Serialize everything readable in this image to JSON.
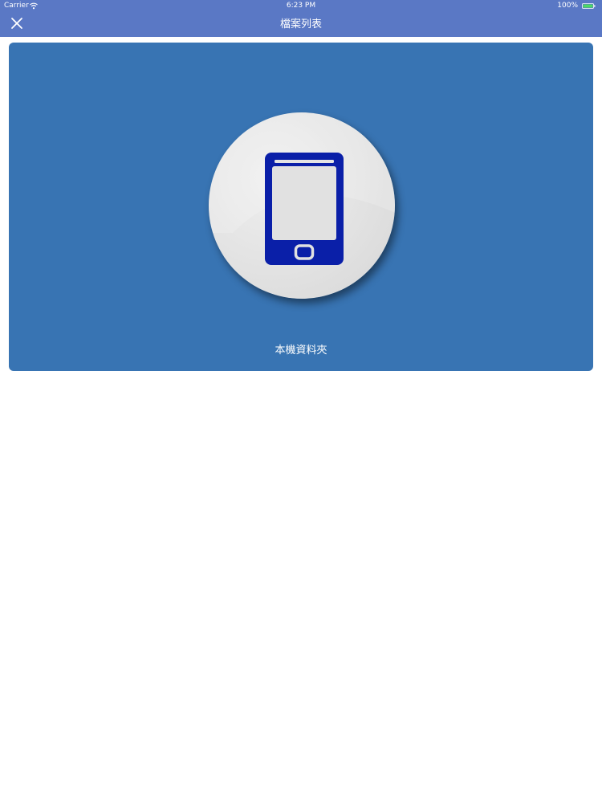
{
  "status_bar": {
    "carrier": "Carrier",
    "time": "6:23 PM",
    "battery": "100%"
  },
  "nav": {
    "title": "檔案列表",
    "close_icon": "close-icon"
  },
  "folder_card": {
    "label": "本機資料夾",
    "icon": "phone-icon"
  },
  "colors": {
    "nav_bg": "#5a78c5",
    "card_bg": "#3874b3",
    "icon_blue": "#0a1fa8",
    "battery_green": "#4cd964"
  }
}
